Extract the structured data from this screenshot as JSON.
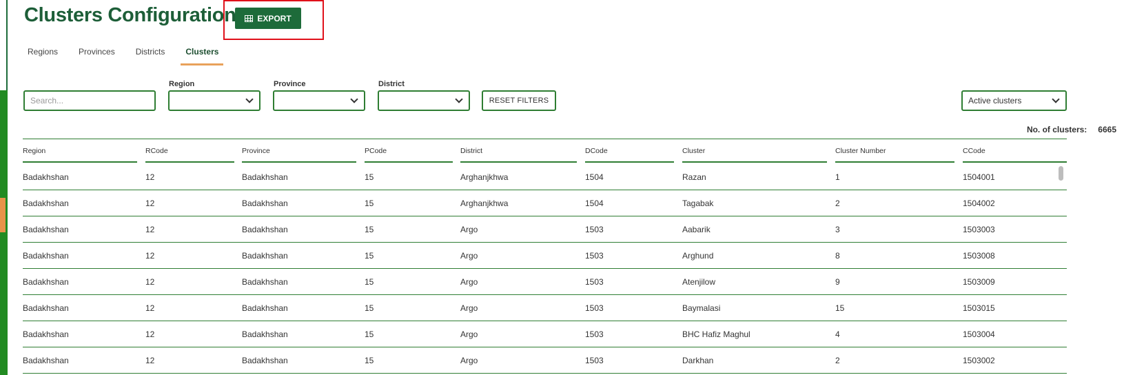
{
  "header": {
    "title": "Clusters Configuration",
    "export_label": "EXPORT"
  },
  "tabs": [
    {
      "label": "Regions",
      "active": false
    },
    {
      "label": "Provinces",
      "active": false
    },
    {
      "label": "Districts",
      "active": false
    },
    {
      "label": "Clusters",
      "active": true
    }
  ],
  "filters": {
    "search_placeholder": "Search...",
    "region_label": "Region",
    "province_label": "Province",
    "district_label": "District",
    "region_value": "",
    "province_value": "",
    "district_value": "",
    "reset_label": "RESET FILTERS",
    "status_value": "Active clusters"
  },
  "summary": {
    "label": "No. of clusters:",
    "count": "6665"
  },
  "table": {
    "columns": [
      "Region",
      "RCode",
      "Province",
      "PCode",
      "District",
      "DCode",
      "Cluster",
      "Cluster Number",
      "CCode"
    ],
    "rows": [
      [
        "Badakhshan",
        "12",
        "Badakhshan",
        "15",
        "Arghanjkhwa",
        "1504",
        "Razan",
        "1",
        "1504001"
      ],
      [
        "Badakhshan",
        "12",
        "Badakhshan",
        "15",
        "Arghanjkhwa",
        "1504",
        "Tagabak",
        "2",
        "1504002"
      ],
      [
        "Badakhshan",
        "12",
        "Badakhshan",
        "15",
        "Argo",
        "1503",
        "Aabarik",
        "3",
        "1503003"
      ],
      [
        "Badakhshan",
        "12",
        "Badakhshan",
        "15",
        "Argo",
        "1503",
        "Arghund",
        "8",
        "1503008"
      ],
      [
        "Badakhshan",
        "12",
        "Badakhshan",
        "15",
        "Argo",
        "1503",
        "Atenjilow",
        "9",
        "1503009"
      ],
      [
        "Badakhshan",
        "12",
        "Badakhshan",
        "15",
        "Argo",
        "1503",
        "Baymalasi",
        "15",
        "1503015"
      ],
      [
        "Badakhshan",
        "12",
        "Badakhshan",
        "15",
        "Argo",
        "1503",
        "BHC Hafiz Maghul",
        "4",
        "1503004"
      ],
      [
        "Badakhshan",
        "12",
        "Badakhshan",
        "15",
        "Argo",
        "1503",
        "Darkhan",
        "2",
        "1503002"
      ]
    ]
  },
  "icons": {
    "export": "table-grid-icon",
    "dropdown": "chevron-down-icon"
  },
  "colors": {
    "primary": "#1d6b3a",
    "accent": "#e8a15a",
    "highlight": "#e0101a",
    "border": "#2e7d32"
  }
}
